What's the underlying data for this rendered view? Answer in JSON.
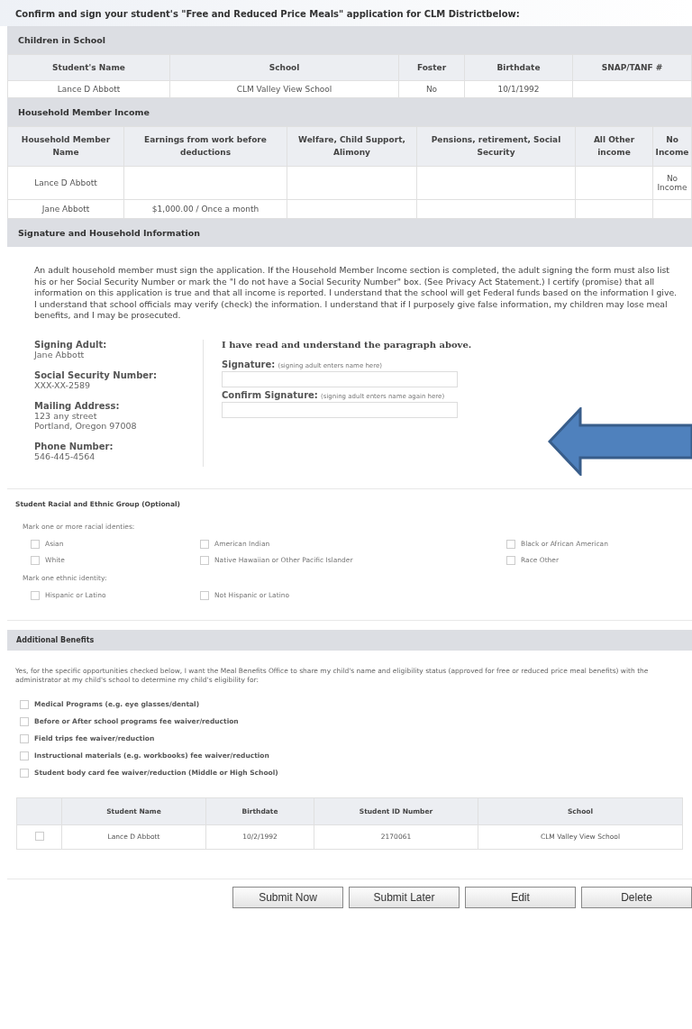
{
  "title": "Confirm and sign your student's \"Free and Reduced Price Meals\" application for CLM Districtbelow:",
  "children_in_school": {
    "heading": "Children in School",
    "columns": [
      "Student's Name",
      "School",
      "Foster",
      "Birthdate",
      "SNAP/TANF #"
    ],
    "rows": [
      [
        "Lance D Abbott",
        "CLM Valley View School",
        "No",
        "10/1/1992",
        ""
      ]
    ]
  },
  "household_income": {
    "heading": "Household Member Income",
    "columns": [
      "Household Member Name",
      "Earnings from work before deductions",
      "Welfare, Child Support, Alimony",
      "Pensions, retirement, Social Security",
      "All Other income",
      "No Income"
    ],
    "rows": [
      [
        "Lance D Abbott",
        "",
        "",
        "",
        "",
        "No Income"
      ],
      [
        "Jane Abbott",
        "$1,000.00 / Once a month",
        "",
        "",
        "",
        ""
      ]
    ]
  },
  "signature": {
    "heading": "Signature and Household Information",
    "paragraph": "An adult household member must sign the application. If the Household Member Income section is completed, the adult signing the form must also list his or her Social Security Number or mark the \"I do not have a Social Security Number\" box. (See Privacy Act Statement.) I certify (promise) that all information on this application is true and that all income is reported. I understand that the school will get Federal funds based on the information I give. I understand that school officials may verify (check) the information. I understand that if I purposely give false information, my children may lose meal benefits, and I may be prosecuted.",
    "details": [
      {
        "label": "Signing Adult:",
        "lines": [
          "Jane Abbott"
        ]
      },
      {
        "label": "Social Security Number:",
        "lines": [
          "XXX-XX-2589"
        ]
      },
      {
        "label": "Mailing Address:",
        "lines": [
          "123 any street",
          "Portland,  Oregon  97008"
        ]
      },
      {
        "label": "Phone Number:",
        "lines": [
          "546-445-4564"
        ]
      }
    ],
    "confirm_text": "I have read and understand the paragraph above.",
    "fields": [
      {
        "label": "Signature:",
        "hint": "(signing adult enters name here)"
      },
      {
        "label": "Confirm Signature:",
        "hint": "(signing adult enters name again here)"
      }
    ]
  },
  "racial_ethnic": {
    "heading": "Student Racial and Ethnic Group (Optional)",
    "race_prompt": "Mark one or more racial identies:",
    "races": [
      {
        "label": "Asian",
        "checked": false
      },
      {
        "label": "American Indian",
        "checked": false
      },
      {
        "label": "Black or African American",
        "checked": false
      },
      {
        "label": "White",
        "checked": false
      },
      {
        "label": "Native Hawaiian or Other Pacific Islander",
        "checked": false
      },
      {
        "label": "Race Other",
        "checked": false
      }
    ],
    "ethnic_prompt": "Mark one ethnic identity:",
    "ethnicities": [
      {
        "label": "Hispanic or Latino",
        "checked": false
      },
      {
        "label": "Not Hispanic or Latino",
        "checked": false
      }
    ]
  },
  "additional_benefits": {
    "heading": "Additional Benefits",
    "paragraph": "Yes, for the specific opportunities checked below, I want the Meal Benefits Office to share my child's name and eligibility status (approved for free or reduced price meal benefits) with the administrator at my child's school to determine my child's eligibility for:",
    "options": [
      {
        "label": "Medical Programs (e.g. eye glasses/dental)",
        "checked": false
      },
      {
        "label": "Before or After school programs fee waiver/reduction",
        "checked": false
      },
      {
        "label": "Field trips fee waiver/reduction",
        "checked": false
      },
      {
        "label": "Instructional materials (e.g. workbooks) fee waiver/reduction",
        "checked": false
      },
      {
        "label": "Student body card fee waiver/reduction (Middle or High School)",
        "checked": false
      }
    ],
    "table": {
      "columns": [
        "Student Name",
        "Birthdate",
        "Student ID Number",
        "School"
      ],
      "rows": [
        {
          "selected": false,
          "cells": [
            "Lance D Abbott",
            "10/2/1992",
            "2170061",
            "CLM Valley View School"
          ]
        }
      ]
    }
  },
  "buttons": [
    "Submit Now",
    "Submit Later",
    "Edit",
    "Delete"
  ]
}
